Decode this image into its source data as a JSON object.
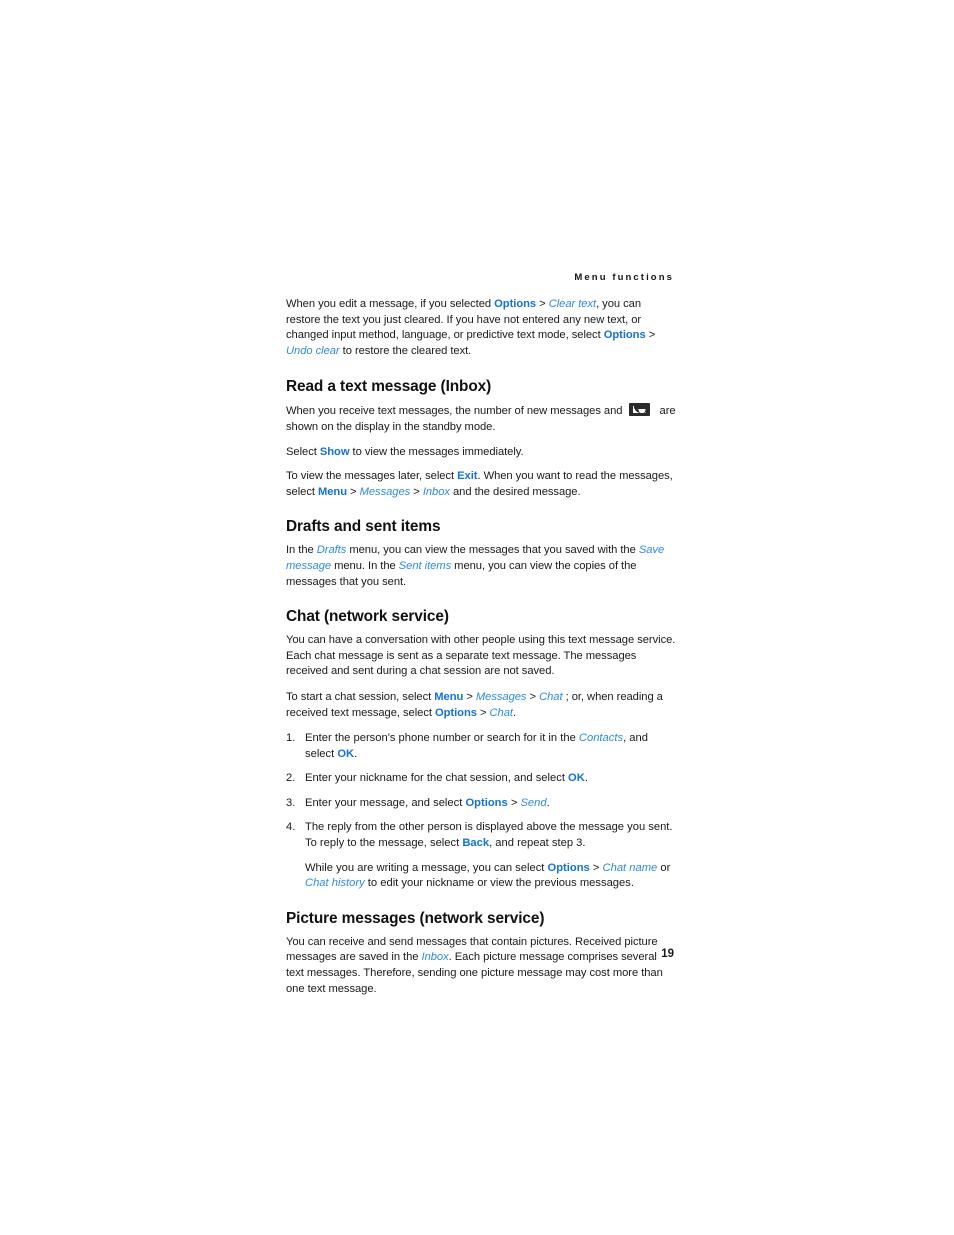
{
  "header": {
    "running_title": "Menu functions"
  },
  "colors": {
    "link_bold": "#1273d4",
    "link_italic": "#2e8bdf",
    "body_text": "#1a1a1a"
  },
  "icons": {
    "new_message_envelope": "envelope-icon"
  },
  "intro": {
    "part1": "When you edit a message, if you selected ",
    "options1": "Options",
    "gt1": " > ",
    "clear_text": "Clear text",
    "part2": ", you can restore the text you just cleared. If you have not entered any new text, or changed input method, language, or predictive text mode, select ",
    "options2": "Options",
    "gt2": " > ",
    "undo_clear": "Undo clear",
    "part3": " to restore the cleared text."
  },
  "sections": [
    {
      "heading": "Read a text message (Inbox)",
      "p1_a": "When you receive text messages, the number of new messages and ",
      "p1_b": " are shown on the display in the standby mode.",
      "p2_a": "Select ",
      "p2_show": "Show",
      "p2_b": " to view the messages immediately.",
      "p3_a": "To view the messages later, select ",
      "p3_exit": "Exit",
      "p3_b": ". When you want to read the messages, select ",
      "p3_menu": "Menu",
      "p3_gt1": " > ",
      "p3_messages": "Messages",
      "p3_gt2": " > ",
      "p3_inbox": "Inbox",
      "p3_c": " and the desired message."
    },
    {
      "heading": "Drafts and sent items",
      "p1_a": "In the ",
      "p1_drafts": "Drafts",
      "p1_b": " menu, you can view the messages that you saved with the ",
      "p1_save_message": "Save message",
      "p1_c": " menu. In the ",
      "p1_sent_items": "Sent items",
      "p1_d": " menu, you can view the copies of the messages that you sent."
    },
    {
      "heading": "Chat (network service)",
      "p1": "You can have a conversation with other people using this text message service. Each chat message is sent as a separate text message. The messages received and sent during a chat session are not saved.",
      "p2_a": "To start a chat session, select ",
      "p2_menu": "Menu",
      "p2_gt1": " > ",
      "p2_messages": "Messages",
      "p2_gt2": " > ",
      "p2_chat": "Chat",
      "p2_b": " ; or, when reading a received text message, select ",
      "p2_options": "Options",
      "p2_gt3": " > ",
      "p2_chat2": "Chat",
      "p2_c": ".",
      "steps": [
        {
          "num": "1.",
          "a": "Enter the person's phone number or search for it in the ",
          "em": "Contacts",
          "b": ", and select ",
          "strong": "OK",
          "c": "."
        },
        {
          "num": "2.",
          "a": "Enter your nickname for the chat session, and select ",
          "strong": "OK",
          "c": "."
        },
        {
          "num": "3.",
          "a": "Enter your message, and select ",
          "strong": "Options",
          "gt": " > ",
          "em": "Send",
          "c": "."
        },
        {
          "num": "4.",
          "a": "The reply from the other person is displayed above the message you sent. To reply to the message, select ",
          "strong": "Back",
          "c": ", and repeat step 3."
        }
      ],
      "substep_a": "While you are writing a message, you can select ",
      "substep_options": "Options",
      "substep_gt": " > ",
      "substep_chat_name": "Chat name",
      "substep_b": " or ",
      "substep_chat_history": "Chat history",
      "substep_c": " to edit your nickname or view the previous messages."
    },
    {
      "heading": "Picture messages (network service)",
      "p1_a": "You can receive and send messages that contain pictures. Received picture messages are saved in the ",
      "p1_inbox": "Inbox",
      "p1_b": ". Each picture message comprises several text messages. Therefore, sending one picture message may cost more than one text message."
    }
  ],
  "footer": {
    "page_number": "19"
  }
}
